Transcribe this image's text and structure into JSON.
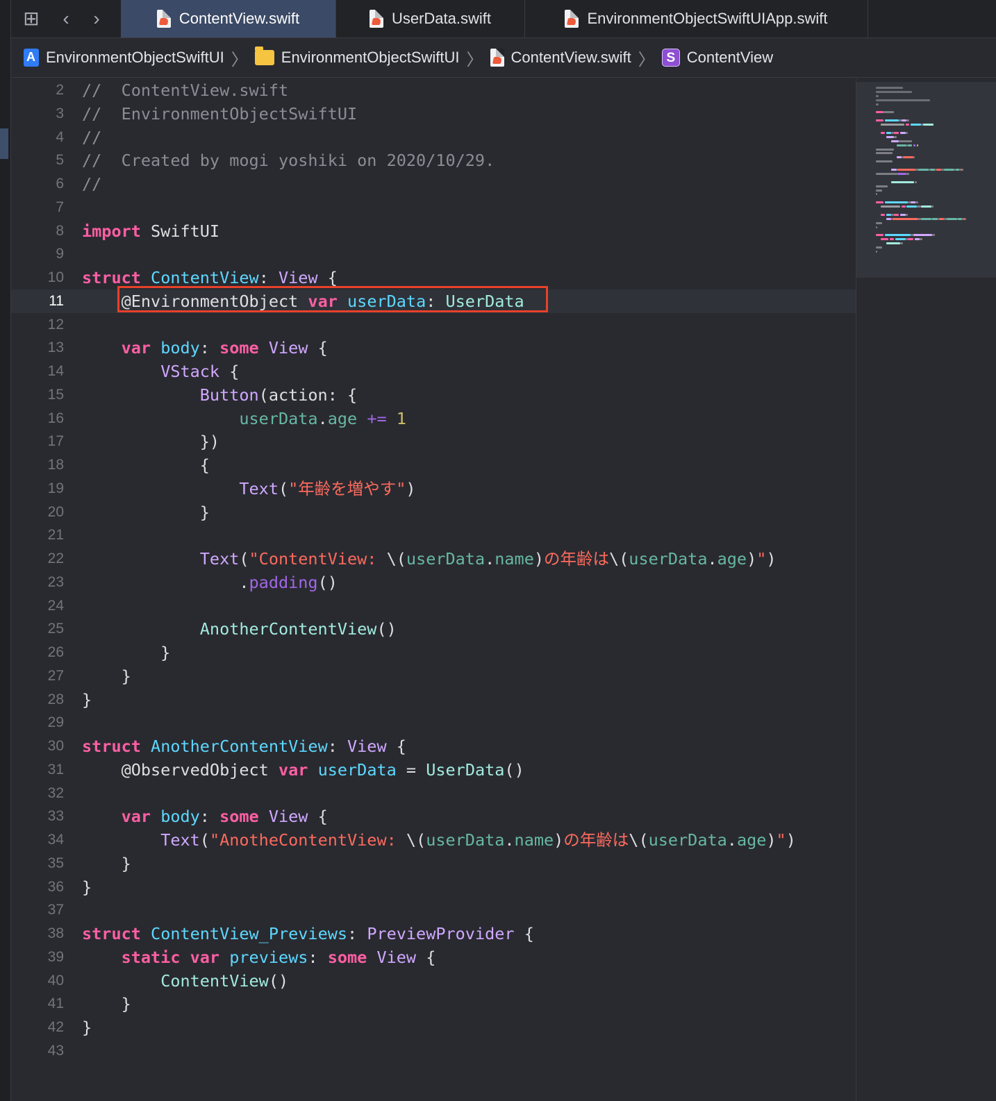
{
  "tabs": [
    {
      "label": "ContentView.swift",
      "active": true
    },
    {
      "label": "UserData.swift",
      "active": false
    },
    {
      "label": "EnvironmentObjectSwiftUIApp.swift",
      "active": false
    }
  ],
  "breadcrumb": [
    {
      "label": "EnvironmentObjectSwiftUI",
      "icon": "project-icon"
    },
    {
      "label": "EnvironmentObjectSwiftUI",
      "icon": "folder-icon"
    },
    {
      "label": "ContentView.swift",
      "icon": "swift-file-icon"
    },
    {
      "label": "ContentView",
      "icon": "struct-icon",
      "badge": "S"
    }
  ],
  "editor": {
    "current_line": "11",
    "lines": [
      {
        "num": "2",
        "code": [
          {
            "t": "//  ContentView.swift",
            "c": "c"
          }
        ]
      },
      {
        "num": "3",
        "code": [
          {
            "t": "//  EnvironmentObjectSwiftUI",
            "c": "c"
          }
        ]
      },
      {
        "num": "4",
        "code": [
          {
            "t": "//",
            "c": "c"
          }
        ]
      },
      {
        "num": "5",
        "code": [
          {
            "t": "//  Created by mogi yoshiki on 2020/10/29.",
            "c": "c"
          }
        ]
      },
      {
        "num": "6",
        "code": [
          {
            "t": "//",
            "c": "c"
          }
        ]
      },
      {
        "num": "7",
        "code": []
      },
      {
        "num": "8",
        "code": [
          {
            "t": "import",
            "c": "k"
          },
          {
            "t": " SwiftUI",
            "c": ""
          }
        ]
      },
      {
        "num": "9",
        "code": []
      },
      {
        "num": "10",
        "code": [
          {
            "t": "struct",
            "c": "k"
          },
          {
            "t": " ",
            "c": ""
          },
          {
            "t": "ContentView",
            "c": "tn"
          },
          {
            "t": ": ",
            "c": ""
          },
          {
            "t": "View",
            "c": "t"
          },
          {
            "t": " {",
            "c": ""
          }
        ]
      },
      {
        "num": "11",
        "code": [
          {
            "t": "    ",
            "c": ""
          },
          {
            "t": "@EnvironmentObject",
            "c": "at"
          },
          {
            "t": " ",
            "c": ""
          },
          {
            "t": "var",
            "c": "k"
          },
          {
            "t": " ",
            "c": ""
          },
          {
            "t": "userData",
            "c": "tn"
          },
          {
            "t": ": ",
            "c": ""
          },
          {
            "t": "UserData",
            "c": "ct"
          }
        ]
      },
      {
        "num": "12",
        "code": []
      },
      {
        "num": "13",
        "code": [
          {
            "t": "    ",
            "c": ""
          },
          {
            "t": "var",
            "c": "k"
          },
          {
            "t": " ",
            "c": ""
          },
          {
            "t": "body",
            "c": "tn"
          },
          {
            "t": ": ",
            "c": ""
          },
          {
            "t": "some",
            "c": "k"
          },
          {
            "t": " ",
            "c": ""
          },
          {
            "t": "View",
            "c": "t"
          },
          {
            "t": " {",
            "c": ""
          }
        ]
      },
      {
        "num": "14",
        "code": [
          {
            "t": "        ",
            "c": ""
          },
          {
            "t": "VStack",
            "c": "t"
          },
          {
            "t": " {",
            "c": ""
          }
        ]
      },
      {
        "num": "15",
        "code": [
          {
            "t": "            ",
            "c": ""
          },
          {
            "t": "Button",
            "c": "t"
          },
          {
            "t": "(action: {",
            "c": ""
          }
        ]
      },
      {
        "num": "16",
        "code": [
          {
            "t": "                ",
            "c": ""
          },
          {
            "t": "userData",
            "c": "p"
          },
          {
            "t": ".",
            "c": ""
          },
          {
            "t": "age",
            "c": "p"
          },
          {
            "t": " ",
            "c": ""
          },
          {
            "t": "+=",
            "c": "tf"
          },
          {
            "t": " ",
            "c": ""
          },
          {
            "t": "1",
            "c": "n"
          }
        ]
      },
      {
        "num": "17",
        "code": [
          {
            "t": "            })",
            "c": ""
          }
        ]
      },
      {
        "num": "18",
        "code": [
          {
            "t": "            {",
            "c": ""
          }
        ]
      },
      {
        "num": "19",
        "code": [
          {
            "t": "                ",
            "c": ""
          },
          {
            "t": "Text",
            "c": "t"
          },
          {
            "t": "(",
            "c": ""
          },
          {
            "t": "\"年齢を増やす\"",
            "c": "s"
          },
          {
            "t": ")",
            "c": ""
          }
        ]
      },
      {
        "num": "20",
        "code": [
          {
            "t": "            }",
            "c": ""
          }
        ]
      },
      {
        "num": "21",
        "code": []
      },
      {
        "num": "22",
        "code": [
          {
            "t": "            ",
            "c": ""
          },
          {
            "t": "Text",
            "c": "t"
          },
          {
            "t": "(",
            "c": ""
          },
          {
            "t": "\"ContentView: ",
            "c": "s"
          },
          {
            "t": "\\(",
            "c": ""
          },
          {
            "t": "userData",
            "c": "p"
          },
          {
            "t": ".",
            "c": ""
          },
          {
            "t": "name",
            "c": "p"
          },
          {
            "t": ")",
            "c": ""
          },
          {
            "t": "の年齢は",
            "c": "s"
          },
          {
            "t": "\\(",
            "c": ""
          },
          {
            "t": "userData",
            "c": "p"
          },
          {
            "t": ".",
            "c": ""
          },
          {
            "t": "age",
            "c": "p"
          },
          {
            "t": ")",
            "c": ""
          },
          {
            "t": "\"",
            "c": "s"
          },
          {
            "t": ")",
            "c": ""
          }
        ]
      },
      {
        "num": "23",
        "code": [
          {
            "t": "                .",
            "c": ""
          },
          {
            "t": "padding",
            "c": "tf"
          },
          {
            "t": "()",
            "c": ""
          }
        ]
      },
      {
        "num": "24",
        "code": []
      },
      {
        "num": "25",
        "code": [
          {
            "t": "            ",
            "c": ""
          },
          {
            "t": "AnotherContentView",
            "c": "ct"
          },
          {
            "t": "()",
            "c": ""
          }
        ]
      },
      {
        "num": "26",
        "code": [
          {
            "t": "        }",
            "c": ""
          }
        ]
      },
      {
        "num": "27",
        "code": [
          {
            "t": "    }",
            "c": ""
          }
        ]
      },
      {
        "num": "28",
        "code": [
          {
            "t": "}",
            "c": ""
          }
        ]
      },
      {
        "num": "29",
        "code": []
      },
      {
        "num": "30",
        "code": [
          {
            "t": "struct",
            "c": "k"
          },
          {
            "t": " ",
            "c": ""
          },
          {
            "t": "AnotherContentView",
            "c": "tn"
          },
          {
            "t": ": ",
            "c": ""
          },
          {
            "t": "View",
            "c": "t"
          },
          {
            "t": " {",
            "c": ""
          }
        ]
      },
      {
        "num": "31",
        "code": [
          {
            "t": "    ",
            "c": ""
          },
          {
            "t": "@ObservedObject",
            "c": "at"
          },
          {
            "t": " ",
            "c": ""
          },
          {
            "t": "var",
            "c": "k"
          },
          {
            "t": " ",
            "c": ""
          },
          {
            "t": "userData",
            "c": "tn"
          },
          {
            "t": " = ",
            "c": ""
          },
          {
            "t": "UserData",
            "c": "ct"
          },
          {
            "t": "()",
            "c": ""
          }
        ]
      },
      {
        "num": "32",
        "code": []
      },
      {
        "num": "33",
        "code": [
          {
            "t": "    ",
            "c": ""
          },
          {
            "t": "var",
            "c": "k"
          },
          {
            "t": " ",
            "c": ""
          },
          {
            "t": "body",
            "c": "tn"
          },
          {
            "t": ": ",
            "c": ""
          },
          {
            "t": "some",
            "c": "k"
          },
          {
            "t": " ",
            "c": ""
          },
          {
            "t": "View",
            "c": "t"
          },
          {
            "t": " {",
            "c": ""
          }
        ]
      },
      {
        "num": "34",
        "code": [
          {
            "t": "        ",
            "c": ""
          },
          {
            "t": "Text",
            "c": "t"
          },
          {
            "t": "(",
            "c": ""
          },
          {
            "t": "\"AnotheContentView: ",
            "c": "s"
          },
          {
            "t": "\\(",
            "c": ""
          },
          {
            "t": "userData",
            "c": "p"
          },
          {
            "t": ".",
            "c": ""
          },
          {
            "t": "name",
            "c": "p"
          },
          {
            "t": ")",
            "c": ""
          },
          {
            "t": "の年齢は",
            "c": "s"
          },
          {
            "t": "\\(",
            "c": ""
          },
          {
            "t": "userData",
            "c": "p"
          },
          {
            "t": ".",
            "c": ""
          },
          {
            "t": "age",
            "c": "p"
          },
          {
            "t": ")",
            "c": ""
          },
          {
            "t": "\"",
            "c": "s"
          },
          {
            "t": ")",
            "c": ""
          }
        ]
      },
      {
        "num": "35",
        "code": [
          {
            "t": "    }",
            "c": ""
          }
        ]
      },
      {
        "num": "36",
        "code": [
          {
            "t": "}",
            "c": ""
          }
        ]
      },
      {
        "num": "37",
        "code": []
      },
      {
        "num": "38",
        "code": [
          {
            "t": "struct",
            "c": "k"
          },
          {
            "t": " ",
            "c": ""
          },
          {
            "t": "ContentView_Previews",
            "c": "tn"
          },
          {
            "t": ": ",
            "c": ""
          },
          {
            "t": "PreviewProvider",
            "c": "t"
          },
          {
            "t": " {",
            "c": ""
          }
        ]
      },
      {
        "num": "39",
        "code": [
          {
            "t": "    ",
            "c": ""
          },
          {
            "t": "static",
            "c": "k"
          },
          {
            "t": " ",
            "c": ""
          },
          {
            "t": "var",
            "c": "k"
          },
          {
            "t": " ",
            "c": ""
          },
          {
            "t": "previews",
            "c": "tn"
          },
          {
            "t": ": ",
            "c": ""
          },
          {
            "t": "some",
            "c": "k"
          },
          {
            "t": " ",
            "c": ""
          },
          {
            "t": "View",
            "c": "t"
          },
          {
            "t": " {",
            "c": ""
          }
        ]
      },
      {
        "num": "40",
        "code": [
          {
            "t": "        ",
            "c": ""
          },
          {
            "t": "ContentView",
            "c": "ct"
          },
          {
            "t": "()",
            "c": ""
          }
        ]
      },
      {
        "num": "41",
        "code": [
          {
            "t": "    }",
            "c": ""
          }
        ]
      },
      {
        "num": "42",
        "code": [
          {
            "t": "}",
            "c": ""
          }
        ]
      },
      {
        "num": "43",
        "code": []
      }
    ]
  },
  "colors": {
    "background": "#292a30",
    "keyword": "#fc5fa3",
    "string": "#fc6a5d",
    "number": "#d0bf69",
    "type_decl": "#5dd8ff",
    "type": "#d0a8ff",
    "property": "#67b7a4",
    "comment": "#8b8d96",
    "highlight_box": "#e8412a",
    "active_tab": "#3b4a66"
  }
}
